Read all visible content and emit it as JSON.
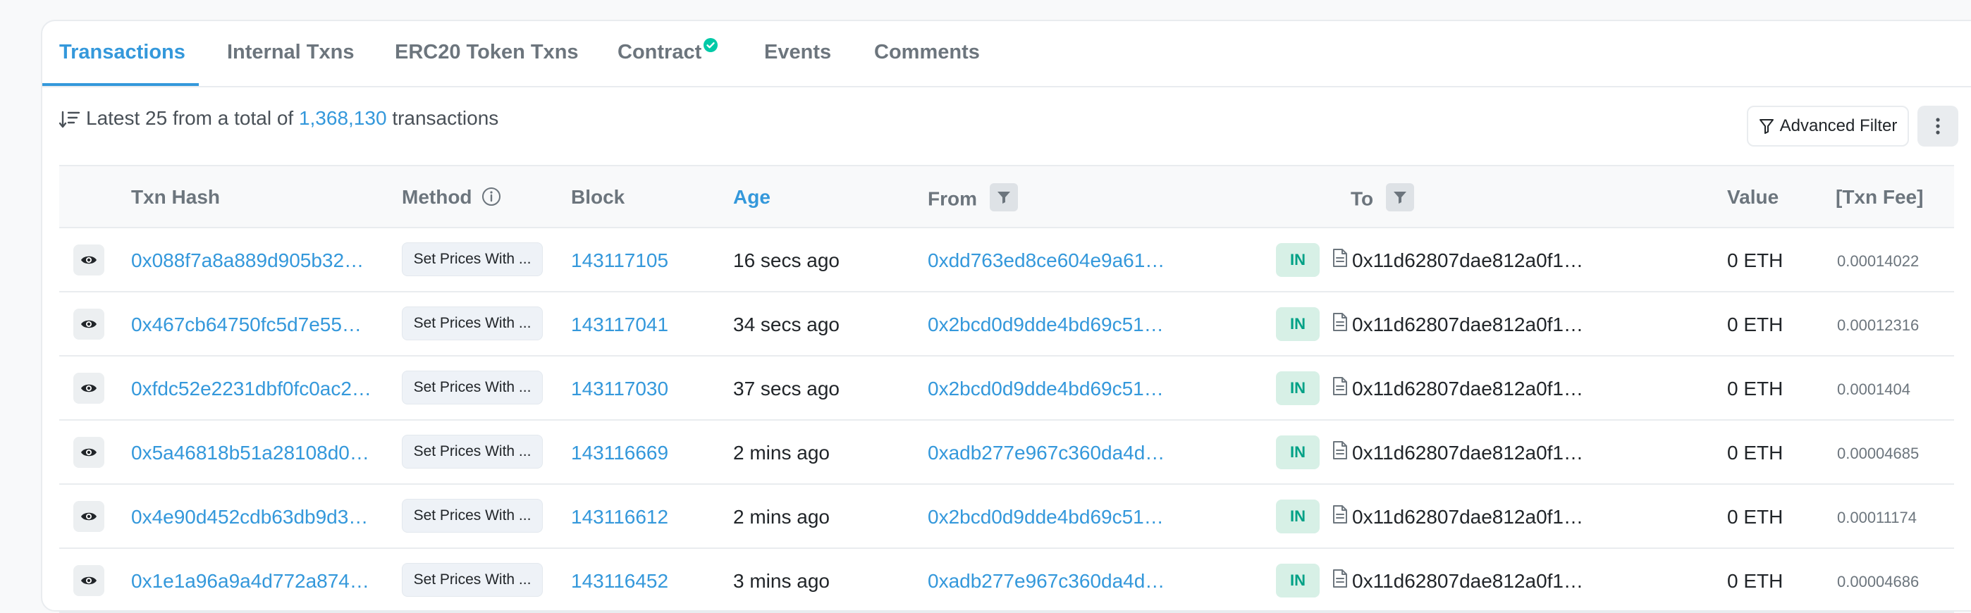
{
  "tabs": [
    {
      "label": "Transactions",
      "active": true
    },
    {
      "label": "Internal Txns",
      "active": false
    },
    {
      "label": "ERC20 Token Txns",
      "active": false
    },
    {
      "label": "Contract",
      "active": false,
      "verified": true
    },
    {
      "label": "Events",
      "active": false
    },
    {
      "label": "Comments",
      "active": false
    }
  ],
  "summary": {
    "prefix": "Latest 25 from a total of",
    "total": "1,368,130",
    "suffix": "transactions"
  },
  "toolbar": {
    "advanced_filter_label": "Advanced Filter"
  },
  "table": {
    "columns": {
      "txn_hash": "Txn Hash",
      "method": "Method",
      "block": "Block",
      "age": "Age",
      "from": "From",
      "to": "To",
      "value": "Value",
      "fee": "[Txn Fee]"
    },
    "rows": [
      {
        "hash": "0x088f7a8a889d905b32…",
        "method": "Set Prices With ...",
        "block": "143117105",
        "age": "16 secs ago",
        "from": "0xdd763ed8ce604e9a61…",
        "direction": "IN",
        "to": "0x11d62807dae812a0f1…",
        "value": "0 ETH",
        "fee": "0.00014022"
      },
      {
        "hash": "0x467cb64750fc5d7e55…",
        "method": "Set Prices With ...",
        "block": "143117041",
        "age": "34 secs ago",
        "from": "0x2bcd0d9dde4bd69c51…",
        "direction": "IN",
        "to": "0x11d62807dae812a0f1…",
        "value": "0 ETH",
        "fee": "0.00012316"
      },
      {
        "hash": "0xfdc52e2231dbf0fc0ac2…",
        "method": "Set Prices With ...",
        "block": "143117030",
        "age": "37 secs ago",
        "from": "0x2bcd0d9dde4bd69c51…",
        "direction": "IN",
        "to": "0x11d62807dae812a0f1…",
        "value": "0 ETH",
        "fee": "0.0001404"
      },
      {
        "hash": "0x5a46818b51a28108d0…",
        "method": "Set Prices With ...",
        "block": "143116669",
        "age": "2 mins ago",
        "from": "0xadb277e967c360da4d…",
        "direction": "IN",
        "to": "0x11d62807dae812a0f1…",
        "value": "0 ETH",
        "fee": "0.00004685"
      },
      {
        "hash": "0x4e90d452cdb63db9d3…",
        "method": "Set Prices With ...",
        "block": "143116612",
        "age": "2 mins ago",
        "from": "0x2bcd0d9dde4bd69c51…",
        "direction": "IN",
        "to": "0x11d62807dae812a0f1…",
        "value": "0 ETH",
        "fee": "0.00011174"
      },
      {
        "hash": "0x1e1a96a9a4d772a874…",
        "method": "Set Prices With ...",
        "block": "143116452",
        "age": "3 mins ago",
        "from": "0xadb277e967c360da4d…",
        "direction": "IN",
        "to": "0x11d62807dae812a0f1…",
        "value": "0 ETH",
        "fee": "0.00004686"
      }
    ]
  },
  "colors": {
    "accent": "#3498db",
    "in_badge_bg": "#d7f0e6",
    "in_badge_text": "#00a186",
    "verified": "#00c9a7"
  }
}
